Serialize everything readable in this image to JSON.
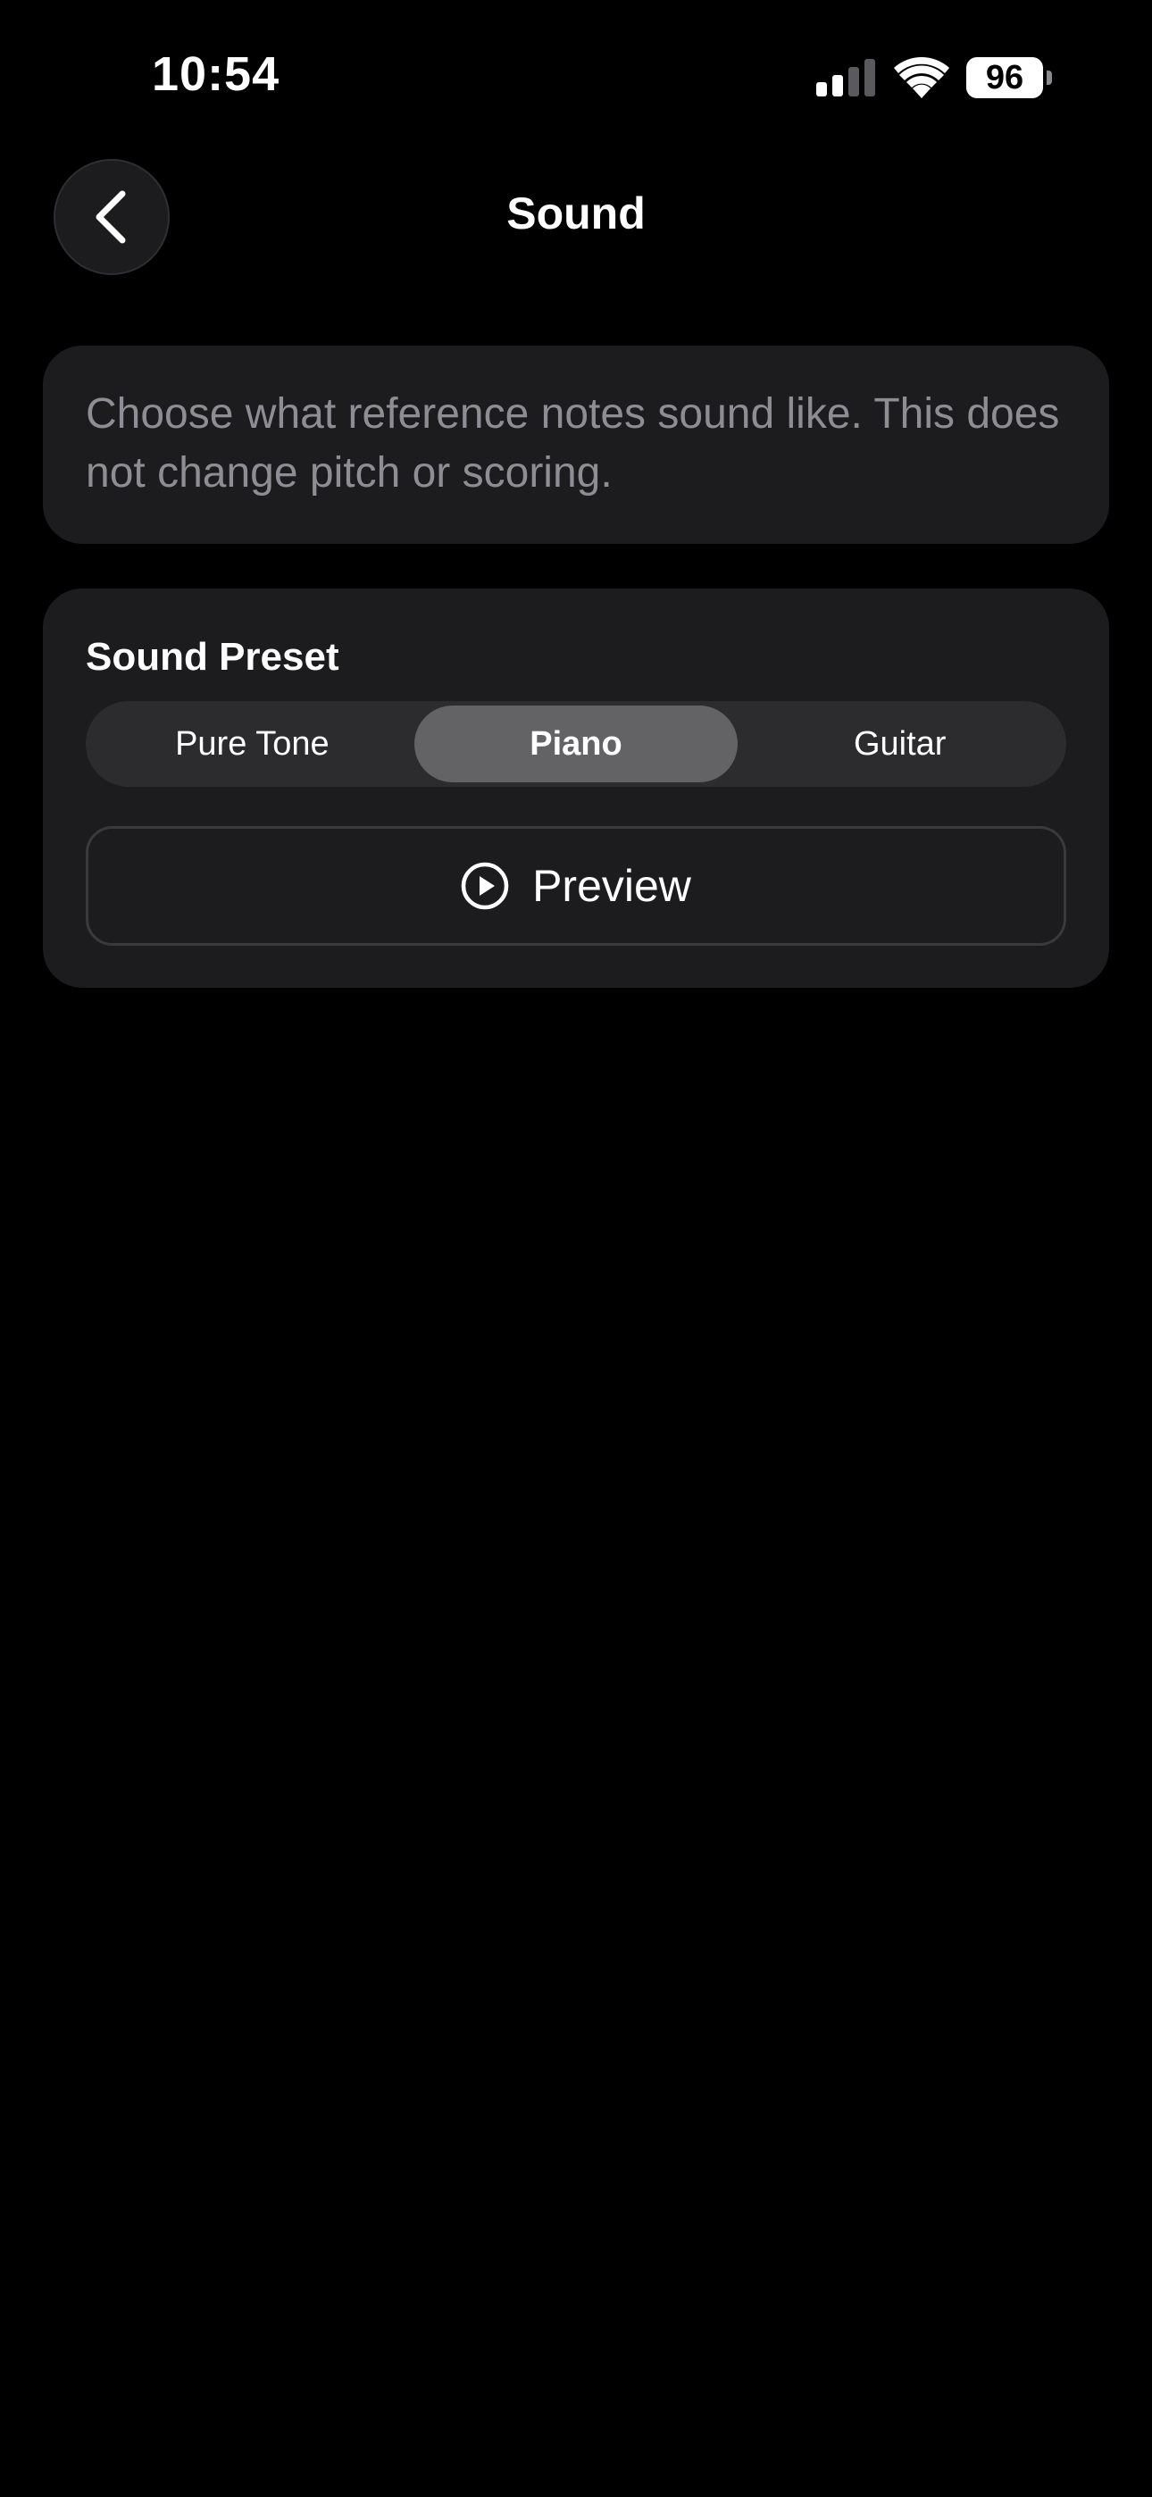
{
  "status_bar": {
    "time": "10:54",
    "signal_icon": "cellular-signal-icon",
    "signal_bars_active": 2,
    "signal_bars_total": 4,
    "wifi_icon": "wifi-icon",
    "battery_level": "96"
  },
  "nav": {
    "back_icon": "chevron-left-icon",
    "title": "Sound"
  },
  "info": {
    "text": "Choose what reference notes sound like. This does not change pitch or scoring."
  },
  "preset": {
    "label": "Sound Preset",
    "options": [
      "Pure Tone",
      "Piano",
      "Guitar"
    ],
    "selected": "Piano"
  },
  "preview": {
    "icon": "play-circle-icon",
    "label": "Preview"
  },
  "colors": {
    "background": "#000000",
    "card": "#1c1c1e",
    "segment_track": "#2c2c2f",
    "segment_selected": "#636366",
    "secondary_text": "#8d8d93"
  }
}
